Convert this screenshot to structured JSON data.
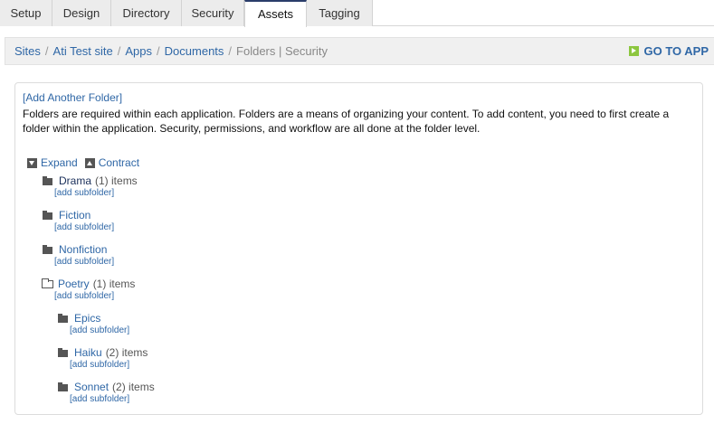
{
  "tabs": [
    {
      "label": "Setup",
      "active": false
    },
    {
      "label": "Design",
      "active": false
    },
    {
      "label": "Directory",
      "active": false
    },
    {
      "label": "Security",
      "active": false
    },
    {
      "label": "Assets",
      "active": true
    },
    {
      "label": "Tagging",
      "active": false
    }
  ],
  "breadcrumb": {
    "items": [
      "Sites",
      "Ati Test site",
      "Apps",
      "Documents"
    ],
    "current": "Folders | Security",
    "separator": "/"
  },
  "go_to_app": {
    "label": "GO TO APP",
    "icon": "arrow-right-icon",
    "color": "#8cc63f"
  },
  "panel": {
    "add_folder": "[Add Another Folder]",
    "description": "Folders are required within each application. Folders are a means of organizing your content. To add content, you need to first create a folder within the application. Security, permissions, and workflow are all done at the folder level."
  },
  "tree_controls": {
    "expand": "Expand",
    "contract": "Contract"
  },
  "folders": [
    {
      "name": "Drama",
      "count": "(1) items",
      "sub": "[add subfolder]",
      "open": false
    },
    {
      "name": "Fiction",
      "count": "",
      "sub": "[add subfolder]",
      "open": false
    },
    {
      "name": "Nonfiction",
      "count": "",
      "sub": "[add subfolder]",
      "open": false
    },
    {
      "name": "Poetry",
      "count": "(1) items",
      "sub": "[add subfolder]",
      "open": true
    },
    {
      "name": "Epics",
      "count": "",
      "sub": "[add subfolder]",
      "open": false
    },
    {
      "name": "Haiku",
      "count": "(2) items",
      "sub": "[add subfolder]",
      "open": false
    },
    {
      "name": "Sonnet",
      "count": "(2) items",
      "sub": "[add subfolder]",
      "open": false
    }
  ],
  "colors": {
    "link": "#2f67a6",
    "active_tab_border": "#2a3d6a"
  }
}
